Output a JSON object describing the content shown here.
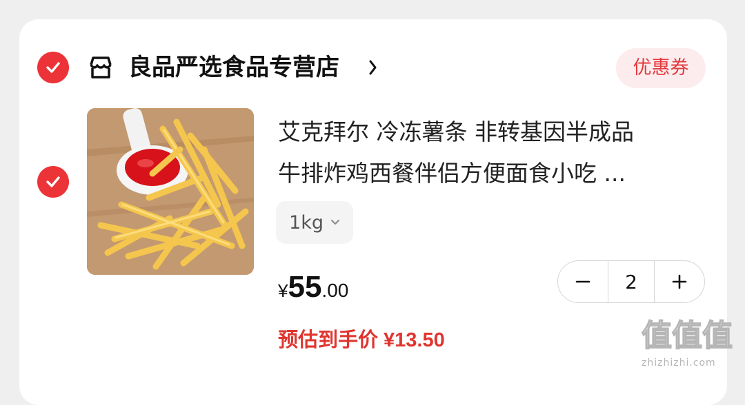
{
  "shop": {
    "name": "良品严选食品专营店",
    "coupon_label": "优惠券"
  },
  "product": {
    "title_line1": "艾克拜尔 冷冻薯条 非转基因半成品",
    "title_line2": "牛排炸鸡西餐伴侣方便面食小吃 ...",
    "spec": "1kg",
    "price_symbol": "¥",
    "price_integer": "55",
    "price_decimal": ".00",
    "quantity": "2",
    "estimate_label": "预估到手价",
    "estimate_price": "¥13.50"
  },
  "watermark": {
    "text": "值值值",
    "url": "zhizhizhi.com"
  },
  "colors": {
    "accent": "#ec3337",
    "price_red": "#e0352f",
    "coupon_bg": "#fdecee"
  },
  "icons": {
    "shop_check": "check-circle-icon",
    "item_check": "check-circle-icon",
    "store": "store-icon",
    "chevron": "chevron-right-icon",
    "spec_dropdown": "chevron-down-icon",
    "minus": "minus-icon",
    "plus": "plus-icon"
  }
}
